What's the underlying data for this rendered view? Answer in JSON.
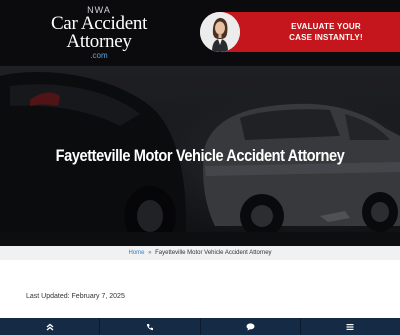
{
  "logo": {
    "top": "NWA",
    "line1": "Car Accident",
    "line2": "Attorney",
    "domain": ".com"
  },
  "cta": {
    "text_line1": "EVALUATE YOUR",
    "text_line2": "CASE INSTANTLY!"
  },
  "hero": {
    "title": "Fayetteville Motor Vehicle Accident Attorney"
  },
  "breadcrumb": {
    "home": "Home",
    "separator": "»",
    "current": "Fayetteville Motor Vehicle Accident Attorney"
  },
  "content": {
    "last_updated": "Last Updated: February 7, 2025"
  },
  "bottom_nav": [
    {
      "icon": "double-chevron-up-icon"
    },
    {
      "icon": "phone-icon"
    },
    {
      "icon": "chat-bubble-icon"
    },
    {
      "icon": "hamburger-menu-icon"
    }
  ],
  "colors": {
    "header_bg": "#0b0b0d",
    "cta_red": "#c4161c",
    "logo_accent": "#5aa7e0",
    "link_blue": "#3b7dbf",
    "bottom_bar": "#152a45"
  }
}
